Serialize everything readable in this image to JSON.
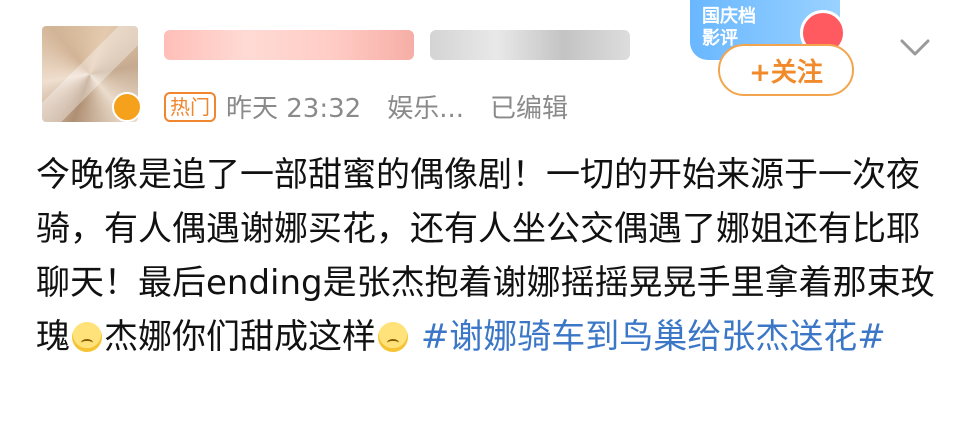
{
  "header": {
    "hot_label": "热门",
    "time": "昨天 23:32",
    "source": "娱乐...",
    "edited": "已编辑"
  },
  "promo": {
    "label": "国庆档 影评",
    "follow_label": "+关注"
  },
  "post": {
    "text": "今晚像是追了一部甜蜜的偶像剧！一切的开始来源于一次夜骑，有人偶遇谢娜买花，还有人坐公交偶遇了娜姐还有比耶聊天！最后ending是张杰抱着谢娜摇摇晃晃手里拿着那束玫瑰",
    "text2": "杰娜你们甜成这样",
    "hashtag": "#谢娜骑车到鸟巢给张杰送花#"
  },
  "icons": {
    "chevron": "chevron-down-icon",
    "emoji": "crying-face-emoji"
  },
  "colors": {
    "accent_orange": "#f08a2a",
    "hashtag_blue": "#3b77c6",
    "meta_gray": "#8a8a8a"
  }
}
